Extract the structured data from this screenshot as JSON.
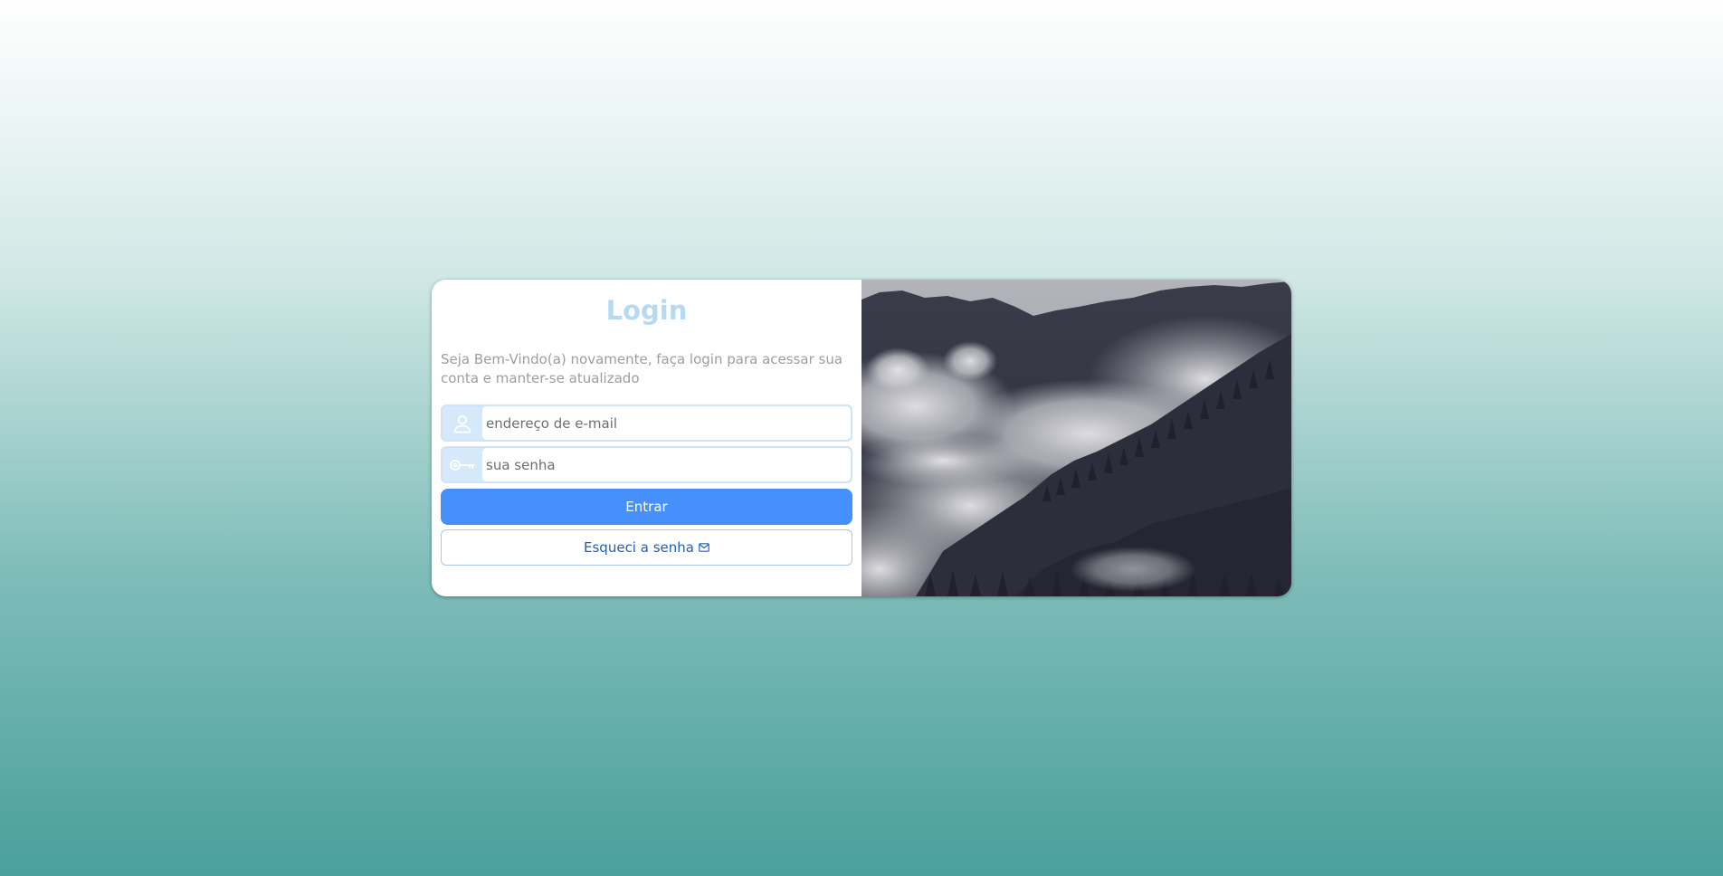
{
  "login": {
    "title": "Login",
    "subtitle": "Seja Bem-Vindo(a) novamente, faça login para acessar sua conta e manter-se atualizado",
    "email_placeholder": "endereço de e-mail",
    "password_placeholder": "sua senha",
    "submit_label": "Entrar",
    "forgot_label": "Esqueci a senha",
    "email_icon": "user-icon",
    "password_icon": "key-icon",
    "forgot_icon": "envelope-icon"
  },
  "colors": {
    "title": "#b6daf3",
    "primary_button": "#4690fb",
    "link": "#1f5fc0"
  }
}
